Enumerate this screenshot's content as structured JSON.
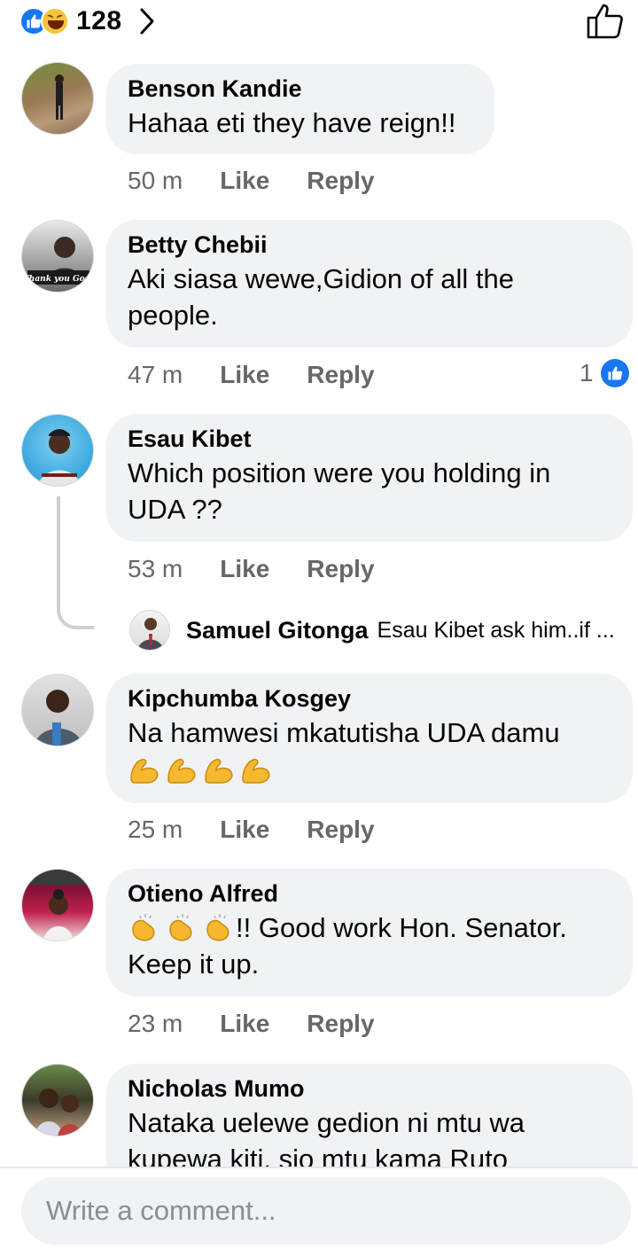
{
  "header": {
    "reaction_count": "128",
    "reaction_icons": [
      "like-icon",
      "haha-icon"
    ],
    "chevron_icon": "chevron-right-icon",
    "like_page_icon": "thumbs-up-outline-icon"
  },
  "comments": [
    {
      "name": "Benson Kandie",
      "text": "Hahaa eti they have reign!!",
      "time": "50 m",
      "like": "Like",
      "reply": "Reply"
    },
    {
      "name": "Betty Chebii",
      "text": "Aki siasa wewe,Gidion of all the people.",
      "time": "47 m",
      "like": "Like",
      "reply": "Reply",
      "likes_count": "1",
      "avatar_caption": "Thank you God!"
    },
    {
      "name": "Esau Kibet",
      "text": "Which position were you  holding in UDA ??",
      "time": "53 m",
      "like": "Like",
      "reply": "Reply"
    },
    {
      "name": "Kipchumba Kosgey",
      "text": "Na hamwesi mkatutisha UDA damu",
      "time": "25 m",
      "like": "Like",
      "reply": "Reply",
      "emoji": [
        "muscle-emoji",
        "muscle-emoji",
        "muscle-emoji",
        "muscle-emoji"
      ]
    },
    {
      "name": "Otieno Alfred",
      "text": "!! Good work Hon. Senator. Keep it up.",
      "time": "23 m",
      "like": "Like",
      "reply": "Reply",
      "emoji": [
        "clap-emoji",
        "clap-emoji",
        "clap-emoji"
      ]
    },
    {
      "name": "Nicholas Mumo",
      "text": "Nataka uelewe gedion ni mtu wa kupewa kiti, sio mtu kama Ruto"
    }
  ],
  "reply_preview": {
    "name": "Samuel Gitonga",
    "text": "Esau Kibet ask him..if ..."
  },
  "composer": {
    "placeholder": "Write a comment..."
  },
  "colors": {
    "accent": "#1877f2",
    "bubble": "#f0f2f5",
    "meta": "#65676b"
  }
}
